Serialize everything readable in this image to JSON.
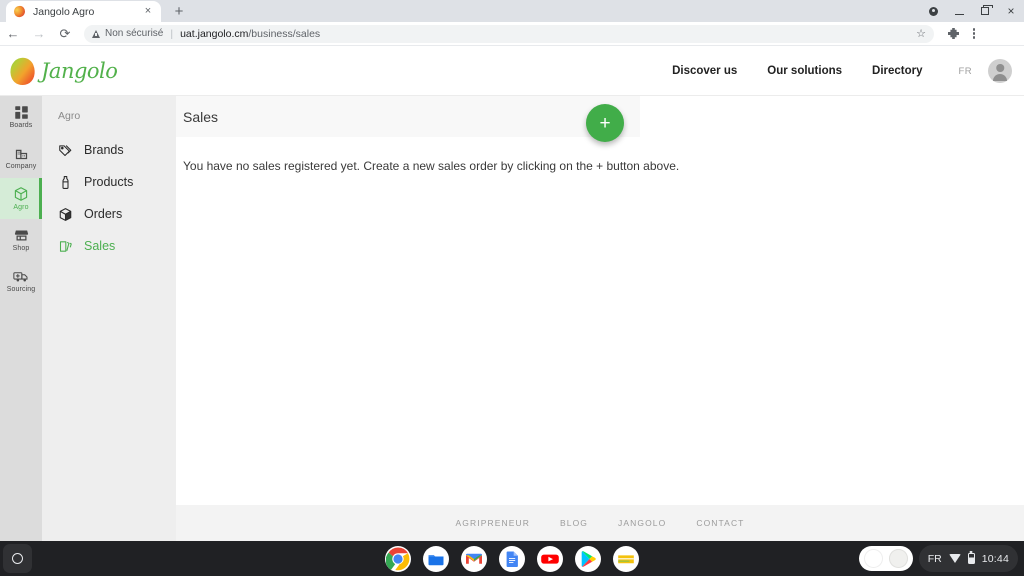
{
  "browser": {
    "tab": {
      "title": "Jangolo Agro",
      "favicon": "mango-favicon",
      "close": "×"
    },
    "new_tab_label": "+",
    "window_controls": {
      "minimize": "minimize-icon",
      "maximize": "maximize-icon",
      "close": "×"
    },
    "nav": {
      "back": "←",
      "forward": "→",
      "reload": "⟳"
    },
    "omnibox": {
      "security_label": "Non sécurisé",
      "separator": "|",
      "url_host": "uat.jangolo.cm",
      "url_path": "/business/sales",
      "bookmark": "☆"
    }
  },
  "site_header": {
    "brand_name": "Jangolo",
    "nav": [
      {
        "label": "Discover us",
        "name": "nav-discover-us"
      },
      {
        "label": "Our solutions",
        "name": "nav-our-solutions"
      },
      {
        "label": "Directory",
        "name": "nav-directory"
      }
    ],
    "language": "FR",
    "avatar": "account-avatar"
  },
  "rail": {
    "items": [
      {
        "label": "Boards",
        "icon": "boards-grid-icon",
        "active": false
      },
      {
        "label": "Company",
        "icon": "company-building-icon",
        "active": false
      },
      {
        "label": "Agro",
        "icon": "agro-box-icon",
        "active": true
      },
      {
        "label": "Shop",
        "icon": "shop-store-icon",
        "active": false
      },
      {
        "label": "Sourcing",
        "icon": "sourcing-truck-icon",
        "active": false
      }
    ]
  },
  "sidebar": {
    "title": "Agro",
    "items": [
      {
        "label": "Brands",
        "icon": "tags-icon",
        "active": false
      },
      {
        "label": "Products",
        "icon": "bottle-icon",
        "active": false
      },
      {
        "label": "Orders",
        "icon": "box-icon",
        "active": false
      },
      {
        "label": "Sales",
        "icon": "receipts-icon",
        "active": true
      }
    ]
  },
  "main": {
    "title": "Sales",
    "add_button_label": "+",
    "empty_message": "You have no sales registered yet. Create a new sales order by clicking on the + button above."
  },
  "footer": {
    "links": [
      {
        "label": "AGRIPRENEUR"
      },
      {
        "label": "BLOG"
      },
      {
        "label": "JANGOLO"
      },
      {
        "label": "CONTACT"
      }
    ]
  },
  "shelf": {
    "launcher": "launcher-circle-icon",
    "apps": [
      {
        "name": "chrome-app-icon",
        "running": true
      },
      {
        "name": "files-app-icon",
        "running": false
      },
      {
        "name": "gmail-app-icon",
        "running": true
      },
      {
        "name": "docs-app-icon",
        "running": false
      },
      {
        "name": "youtube-app-icon",
        "running": false
      },
      {
        "name": "play-store-app-icon",
        "running": false
      },
      {
        "name": "notes-app-icon",
        "running": false
      }
    ],
    "tray": {
      "language": "FR",
      "wifi": "wifi-icon",
      "battery": "battery-icon",
      "clock": "10:44"
    }
  },
  "colors": {
    "brand_green": "#4caf50",
    "fab_green": "#41ad49",
    "rail_bg": "#dcdcdc",
    "sidebar_bg": "#eeeeee",
    "shelf_bg": "#202124"
  }
}
